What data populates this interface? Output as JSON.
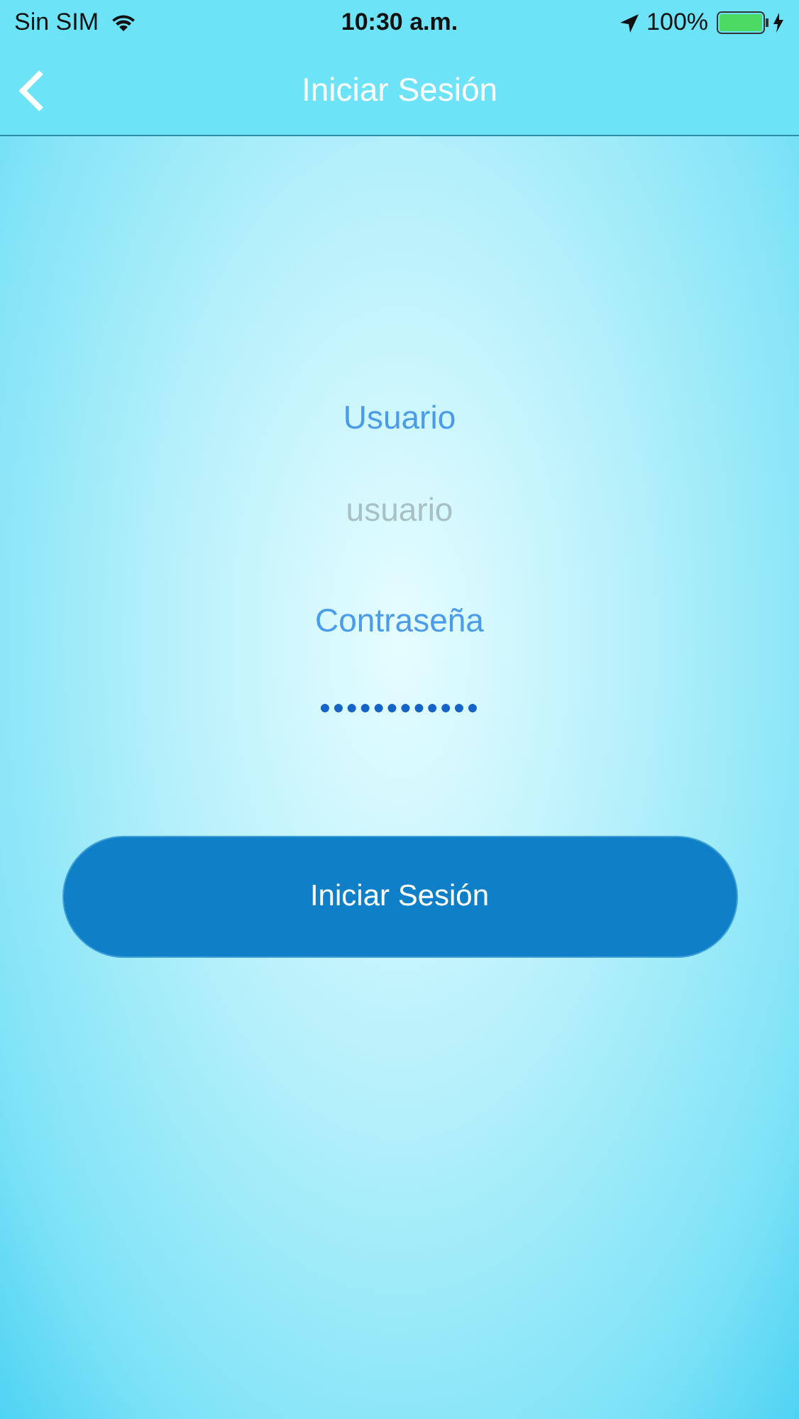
{
  "status_bar": {
    "carrier": "Sin SIM",
    "time": "10:30 a.m.",
    "battery": "100%"
  },
  "nav_bar": {
    "title": "Iniciar Sesión"
  },
  "form": {
    "username_label": "Usuario",
    "username_field": {
      "placeholder": "usuario"
    },
    "password_label": "Contraseña",
    "password_field": {
      "value": "●●●●●●●●●●●●"
    },
    "submit": "Iniciar Sesión"
  }
}
